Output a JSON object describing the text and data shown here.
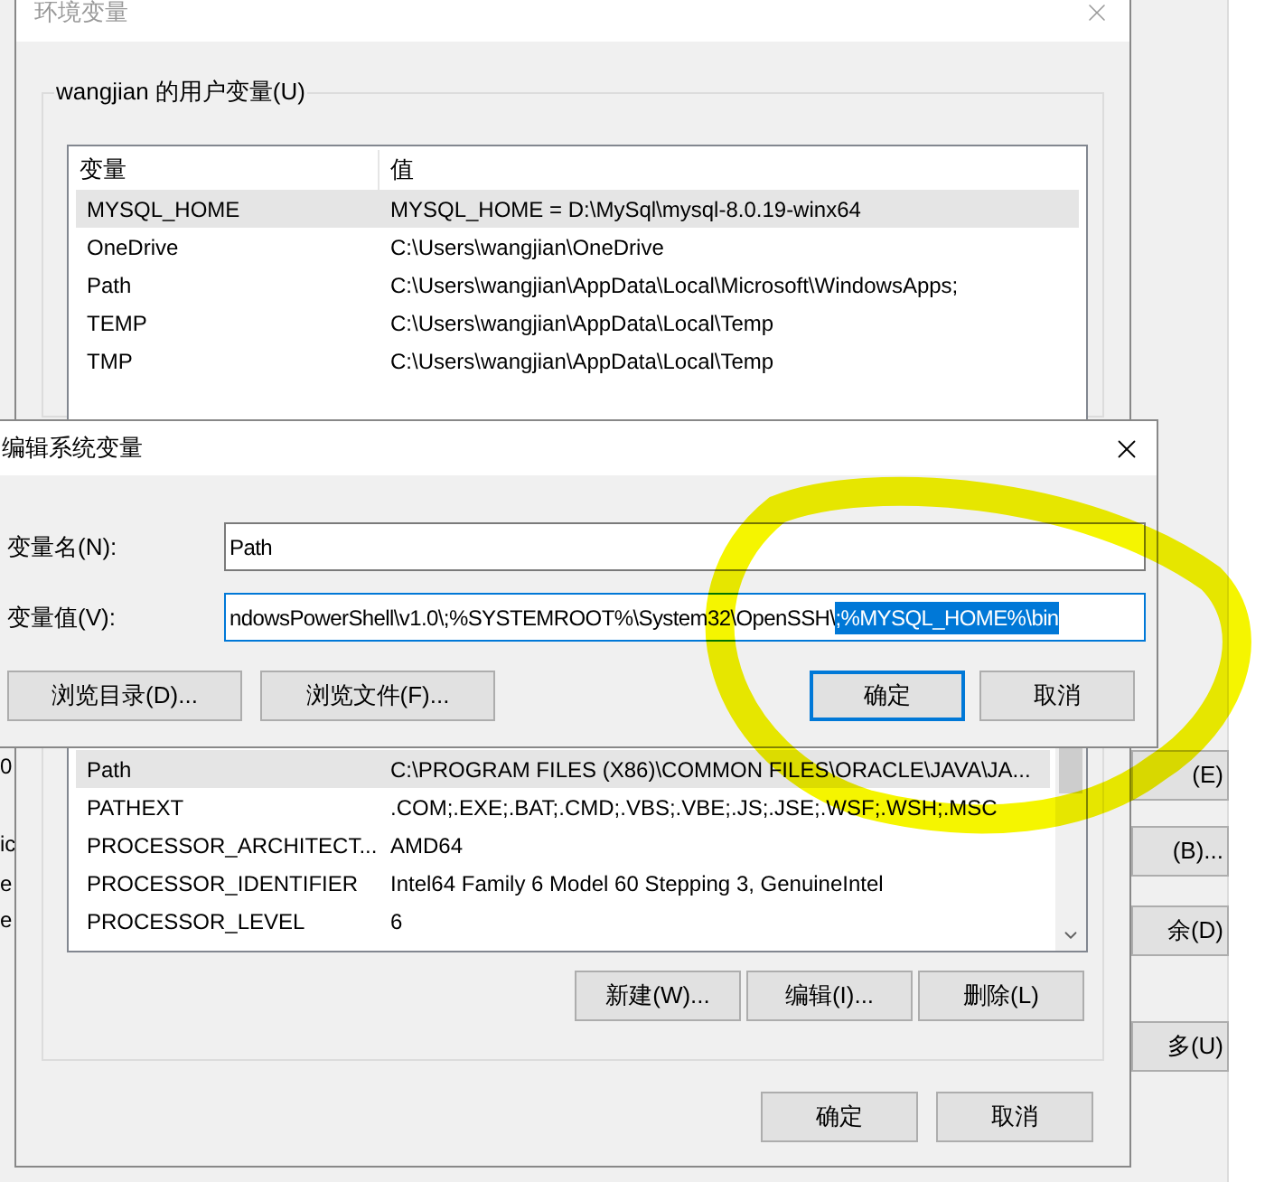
{
  "background_window": {
    "left_fragments": [
      "0",
      "ic",
      "e",
      "e"
    ],
    "right_buttons": [
      "(E)",
      "(B)...",
      "余(D)",
      "多(U)"
    ]
  },
  "env_dialog": {
    "title": "环境变量",
    "user_group": {
      "label": "wangjian 的用户变量(U)",
      "columns": [
        "变量",
        "值"
      ],
      "rows": [
        {
          "name": "MYSQL_HOME",
          "value": "MYSQL_HOME  = D:\\MySql\\mysql-8.0.19-winx64",
          "selected": true
        },
        {
          "name": "OneDrive",
          "value": "C:\\Users\\wangjian\\OneDrive",
          "selected": false
        },
        {
          "name": "Path",
          "value": "C:\\Users\\wangjian\\AppData\\Local\\Microsoft\\WindowsApps;",
          "selected": false
        },
        {
          "name": "TEMP",
          "value": "C:\\Users\\wangjian\\AppData\\Local\\Temp",
          "selected": false
        },
        {
          "name": "TMP",
          "value": "C:\\Users\\wangjian\\AppData\\Local\\Temp",
          "selected": false
        }
      ]
    },
    "system_group": {
      "rows": [
        {
          "name": "Path",
          "value": "C:\\PROGRAM FILES (X86)\\COMMON FILES\\ORACLE\\JAVA\\JA...",
          "selected": true
        },
        {
          "name": "PATHEXT",
          "value": ".COM;.EXE;.BAT;.CMD;.VBS;.VBE;.JS;.JSE;.WSF;.WSH;.MSC",
          "selected": false
        },
        {
          "name": "PROCESSOR_ARCHITECT...",
          "value": "AMD64",
          "selected": false
        },
        {
          "name": "PROCESSOR_IDENTIFIER",
          "value": "Intel64 Family 6 Model 60 Stepping 3, GenuineIntel",
          "selected": false
        },
        {
          "name": "PROCESSOR_LEVEL",
          "value": "6",
          "selected": false
        }
      ],
      "buttons": [
        "新建(W)...",
        "编辑(I)...",
        "删除(L)"
      ]
    },
    "buttons": [
      "确定",
      "取消"
    ]
  },
  "edit_dialog": {
    "title": "编辑系统变量",
    "fields": [
      {
        "label": "变量名(N):",
        "value": "Path"
      },
      {
        "label": "变量值(V):",
        "value": "ndowsPowerShell\\v1.0\\;%SYSTEMROOT%\\System32\\OpenSSH\\",
        "selected_text": ";%MYSQL_HOME%\\bin"
      }
    ],
    "browse_buttons": [
      "浏览目录(D)...",
      "浏览文件(F)..."
    ],
    "buttons": [
      {
        "label": "确定",
        "default": true
      },
      {
        "label": "取消",
        "default": false
      }
    ]
  }
}
